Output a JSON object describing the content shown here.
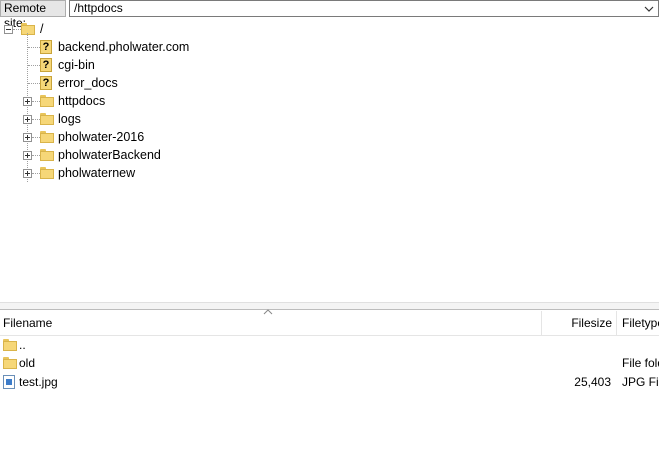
{
  "remote_site": {
    "label": "Remote site:",
    "path": "/httpdocs"
  },
  "tree": {
    "root": "/",
    "items": [
      {
        "label": "backend.pholwater.com",
        "icon": "question-folder-icon",
        "expandable": false
      },
      {
        "label": "cgi-bin",
        "icon": "question-folder-icon",
        "expandable": false
      },
      {
        "label": "error_docs",
        "icon": "question-folder-icon",
        "expandable": false
      },
      {
        "label": "httpdocs",
        "icon": "folder-icon",
        "expandable": true
      },
      {
        "label": "logs",
        "icon": "folder-icon",
        "expandable": true
      },
      {
        "label": "pholwater-2016",
        "icon": "folder-icon",
        "expandable": true
      },
      {
        "label": "pholwaterBackend",
        "icon": "folder-icon",
        "expandable": true
      },
      {
        "label": "pholwaternew",
        "icon": "folder-icon",
        "expandable": true
      }
    ]
  },
  "file_list": {
    "columns": {
      "filename": "Filename",
      "filesize": "Filesize",
      "filetype": "Filetype"
    },
    "rows": [
      {
        "name": "..",
        "size": "",
        "type": "",
        "icon": "folder-icon"
      },
      {
        "name": "old",
        "size": "",
        "type": "File folder",
        "icon": "folder-icon"
      },
      {
        "name": "test.jpg",
        "size": "25,403",
        "type": "JPG File",
        "icon": "image-file-icon"
      }
    ]
  },
  "colors": {
    "folder": "#f6d778",
    "selection_text": "#000000"
  }
}
